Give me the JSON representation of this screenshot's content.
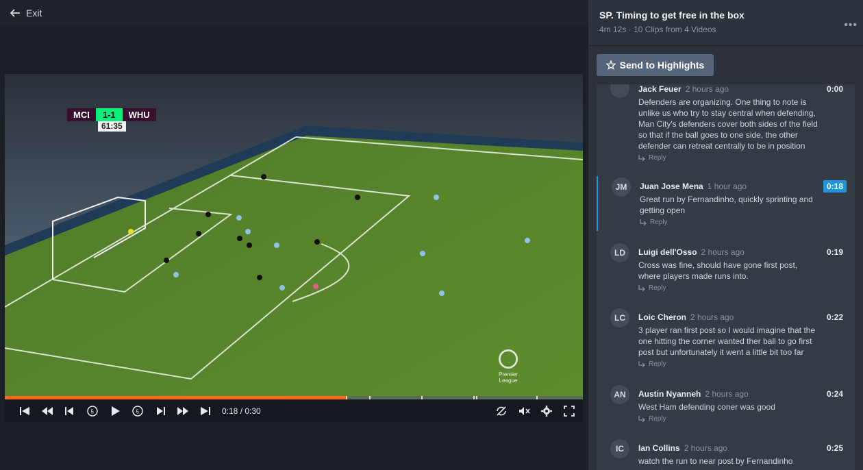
{
  "topbar": {
    "exit_label": "Exit",
    "exit_icon": "arrow-left-icon"
  },
  "player": {
    "scorebug": {
      "home": "MCI",
      "score": "1-1",
      "away": "WHU",
      "clock": "61:35"
    },
    "watermark": "Premier League",
    "progress": {
      "played_fraction": 0.59,
      "marker_fractions": [
        0.59,
        0.63,
        0.72,
        0.81,
        0.815,
        0.92
      ]
    },
    "controls": {
      "left_icons": [
        "skip-start-icon",
        "rewind-icon",
        "step-back-icon",
        "replay-5-icon",
        "play-icon",
        "forward-5-icon",
        "step-forward-icon",
        "fast-forward-icon",
        "skip-end-icon"
      ],
      "time": "0:18 / 0:30",
      "right_icons": [
        "loop-off-icon",
        "mute-icon",
        "settings-gear-icon",
        "fullscreen-icon"
      ]
    }
  },
  "panel": {
    "title": "SP. Timing to get free in the box",
    "duration": "4m 12s",
    "sep": "·",
    "summary": "10 Clips from 4 Videos",
    "more_icon": "ellipsis-icon",
    "highlight_button": "Send to Highlights",
    "reply_label": "Reply",
    "comments": [
      {
        "initials": "",
        "name": "Jack Feuer",
        "ago": "2 hours ago",
        "time": "0:00",
        "active": false,
        "lines": [
          "Defenders are organizing. One thing to note is",
          "unlike us who try to stay central when defending,",
          "Man City's defenders cover both sides of the field",
          "so that if the ball goes to one side, the other",
          "defender can retreat centrally to be in position"
        ]
      },
      {
        "initials": "JM",
        "name": "Juan Jose Mena",
        "ago": "1 hour ago",
        "time": "0:18",
        "active": true,
        "lines": [
          "Great run by Fernandinho, quickly sprinting and",
          "getting open"
        ]
      },
      {
        "initials": "LD",
        "name": "Luigi dell'Osso",
        "ago": "2 hours ago",
        "time": "0:19",
        "active": false,
        "lines": [
          "Cross was fine, should have gone first post,",
          "where players made runs into."
        ]
      },
      {
        "initials": "LC",
        "name": "Loic Cheron",
        "ago": "2 hours ago",
        "time": "0:22",
        "active": false,
        "lines": [
          "3 player ran first post so I would imagine that the",
          "one hitting the corner wanted ther ball to go first",
          "post but unfortunately it went a little bit too far"
        ]
      },
      {
        "initials": "AN",
        "name": "Austin Nyanneh",
        "ago": "2 hours ago",
        "time": "0:24",
        "active": false,
        "lines": [
          "West Ham defending coner was good"
        ]
      },
      {
        "initials": "IC",
        "name": "Ian Collins",
        "ago": "2 hours ago",
        "time": "0:25",
        "active": false,
        "lines": [
          "watch the run to near post by Fernandinho"
        ]
      }
    ]
  }
}
